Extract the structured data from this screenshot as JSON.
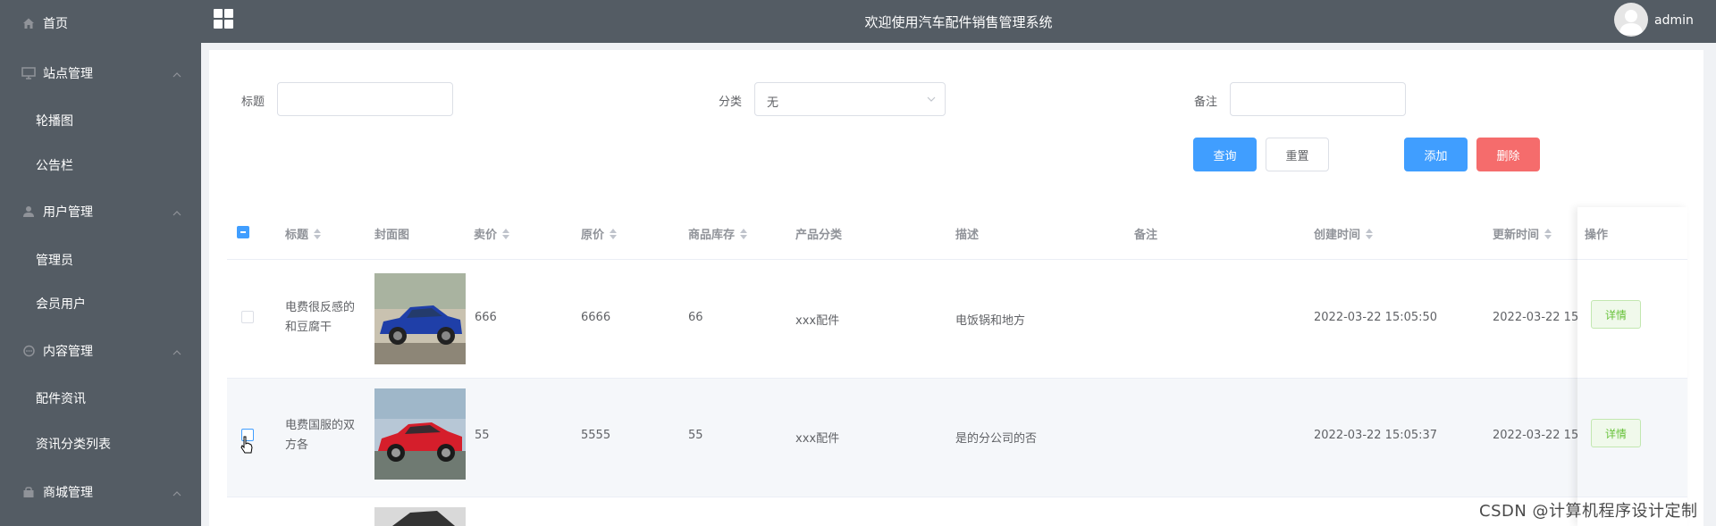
{
  "header": {
    "title": "欢迎使用汽车配件销售管理系统",
    "username": "admin"
  },
  "sidebar": {
    "home": "首页",
    "groups": [
      {
        "label": "站点管理",
        "items": [
          "轮播图",
          "公告栏"
        ]
      },
      {
        "label": "用户管理",
        "items": [
          "管理员",
          "会员用户"
        ]
      },
      {
        "label": "内容管理",
        "items": [
          "配件资讯",
          "资讯分类列表"
        ]
      },
      {
        "label": "商城管理",
        "items": []
      }
    ]
  },
  "search": {
    "title_label": "标题",
    "title_value": "",
    "category_label": "分类",
    "category_value": "无",
    "remark_label": "备注",
    "remark_value": "",
    "query_button": "查询",
    "reset_button": "重置",
    "add_button": "添加",
    "delete_button": "删除"
  },
  "table": {
    "columns": [
      "标题",
      "封面图",
      "卖价",
      "原价",
      "商品库存",
      "产品分类",
      "描述",
      "备注",
      "创建时间",
      "更新时间",
      "操作"
    ],
    "rows": [
      {
        "title": "电费很反感的和豆腐干",
        "price": "666",
        "original_price": "6666",
        "stock": "66",
        "category": "xxx配件",
        "description": "电饭锅和地方",
        "remark": "",
        "created": "2022-03-22 15:05:50",
        "updated": "2022-03-22 15:",
        "action": "详情"
      },
      {
        "title": "电费国服的双方各",
        "price": "55",
        "original_price": "5555",
        "stock": "55",
        "category": "xxx配件",
        "description": "是的分公司的否",
        "remark": "",
        "created": "2022-03-22 15:05:37",
        "updated": "2022-03-22 15:",
        "action": "详情"
      }
    ]
  },
  "watermark": "CSDN @计算机程序设计定制",
  "colors": {
    "sidebar": "#545c64",
    "primary": "#409eff",
    "danger": "#f56c6c",
    "success": "#67c23a"
  }
}
